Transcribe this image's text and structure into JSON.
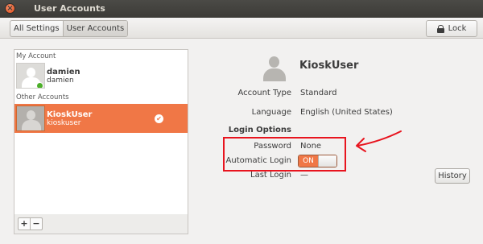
{
  "window": {
    "title": "User Accounts"
  },
  "toolbar": {
    "breadcrumbs": [
      "All Settings",
      "User Accounts"
    ],
    "lock_label": "Lock"
  },
  "sidebar": {
    "my_account_label": "My Account",
    "other_accounts_label": "Other Accounts",
    "users": [
      {
        "name": "damien",
        "login": "damien",
        "online": true,
        "selected": false
      },
      {
        "name": "KioskUser",
        "login": "kioskuser",
        "selected": true
      }
    ],
    "add_label": "+",
    "remove_label": "−"
  },
  "details": {
    "name": "KioskUser",
    "account_type_label": "Account Type",
    "account_type_value": "Standard",
    "language_label": "Language",
    "language_value": "English (United States)",
    "login_options_label": "Login Options",
    "password_label": "Password",
    "password_value": "None",
    "automatic_login_label": "Automatic Login",
    "automatic_login_state": "ON",
    "last_login_label": "Last Login",
    "last_login_value": "—",
    "history_label": "History"
  },
  "colors": {
    "accent": "#f07746",
    "annotation": "#e8141e",
    "titlebar": "#3c3b37"
  },
  "icons": [
    "close-icon",
    "lock-icon",
    "user-avatar-icon",
    "online-status-icon",
    "check-icon",
    "arrow-annotation-icon"
  ]
}
